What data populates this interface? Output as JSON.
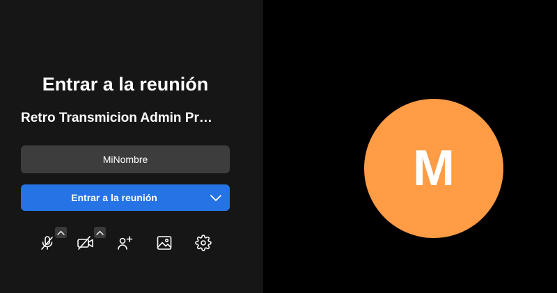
{
  "prejoin": {
    "title": "Entrar a la reunión",
    "meeting_name": "Retro Transmicion Admin Pr…",
    "name_input": {
      "value": "MiNombre",
      "placeholder": ""
    },
    "join_button_label": "Entrar a la reunión"
  },
  "toolbar": {
    "items": [
      {
        "name": "microphone-muted",
        "icon": "mic-off-icon",
        "has_options": true
      },
      {
        "name": "camera-off",
        "icon": "video-off-icon",
        "has_options": true
      },
      {
        "name": "invite-people",
        "icon": "user-plus-icon",
        "has_options": false
      },
      {
        "name": "background",
        "icon": "image-icon",
        "has_options": false
      },
      {
        "name": "settings",
        "icon": "gear-icon",
        "has_options": false
      }
    ]
  },
  "preview": {
    "avatar_initial": "M",
    "avatar_color": "#ff9c45"
  },
  "colors": {
    "panel_bg": "#161616",
    "input_bg": "#3d3d3d",
    "accent": "#2673e6",
    "preview_bg": "#000000"
  }
}
